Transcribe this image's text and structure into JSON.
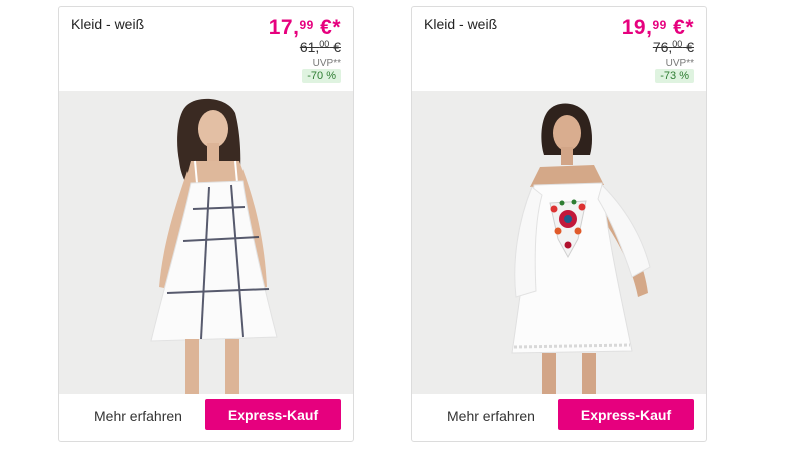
{
  "products": [
    {
      "title": "Kleid - weiß",
      "price_main": "17,",
      "price_cents": "99",
      "price_suffix": " €*",
      "old_price_main": "61,",
      "old_price_cents": "00",
      "old_price_suffix": " €",
      "uvp_label": "UVP**",
      "discount": "-70 %",
      "image": "dress-checked-straps",
      "more_label": "Mehr erfahren",
      "express_label": "Express-Kauf"
    },
    {
      "title": "Kleid - weiß",
      "price_main": "19,",
      "price_cents": "99",
      "price_suffix": " €*",
      "old_price_main": "76,",
      "old_price_cents": "00",
      "old_price_suffix": " €",
      "uvp_label": "UVP**",
      "discount": "-73 %",
      "image": "dress-embroidered-cold-shoulder",
      "more_label": "Mehr erfahren",
      "express_label": "Express-Kauf"
    }
  ],
  "colors": {
    "accent": "#e6007e",
    "discount_bg": "#dff3e0",
    "discount_text": "#2e7d32"
  }
}
